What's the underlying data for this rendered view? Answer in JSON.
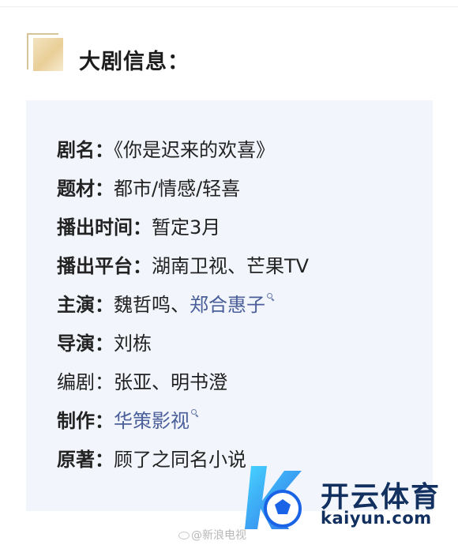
{
  "section": {
    "title": "大剧信息："
  },
  "info": [
    {
      "label": "剧名：",
      "value": "《你是迟来的欢喜》"
    },
    {
      "label": "题材：",
      "value": "都市/情感/轻喜"
    },
    {
      "label": "播出时间：",
      "value": "暂定3月"
    },
    {
      "label": "播出平台：",
      "value": "湖南卫视、芒果TV"
    },
    {
      "label": "主演：",
      "value": "魏哲鸣、",
      "link": "郑合惠子"
    },
    {
      "label": "导演：",
      "value": "刘栋"
    },
    {
      "label": "编剧：",
      "value": "张亚、明书澄"
    },
    {
      "label": "制作：",
      "link": "华策影视"
    },
    {
      "label": "原著：",
      "value": "顾了之同名小说"
    }
  ],
  "watermark": {
    "brand": "开云体育",
    "url": "kaiyun.com",
    "source": "@新浪电视"
  },
  "colors": {
    "panel_bg": "#f2f5fc",
    "link": "#4a5f9a",
    "gold": "#e9cf98",
    "brand": "#12305f"
  },
  "icons": [
    "search-icon",
    "kaiyun-logo-icon",
    "weibo-icon"
  ]
}
